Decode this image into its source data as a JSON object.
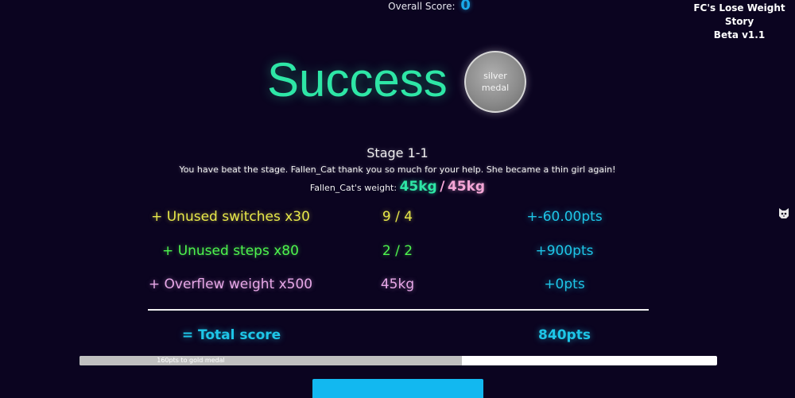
{
  "header": {
    "overall_label": "Overall Score:",
    "overall_value": "0",
    "game_title_line1": "FC's Lose Weight Story",
    "game_title_line2": "Beta v1.1"
  },
  "result": {
    "title": "Success",
    "medal_line1": "silver",
    "medal_line2": "medal",
    "stage_name": "Stage 1-1",
    "message": "You have beat the stage. Fallen_Cat thank you so much for your help. She became a thin girl again!",
    "weight_label": "Fallen_Cat's weight:",
    "weight_current": "45kg",
    "weight_separator": "/",
    "weight_goal": "45kg"
  },
  "score_rows": [
    {
      "label": "+ Unused switches x30",
      "value": "9 / 4",
      "points": "+-60.00pts"
    },
    {
      "label": "+ Unused steps x80",
      "value": "2 / 2",
      "points": "+900pts"
    },
    {
      "label": "+ Overflew weight x500",
      "value": "45kg",
      "points": "+0pts"
    }
  ],
  "total": {
    "label": "= Total score",
    "points": "840pts"
  },
  "progress": {
    "text": "160pts to gold medal",
    "fraction": 0.6
  },
  "icons": {
    "side": "cat-face-icon",
    "medal": "silver-medal-icon"
  },
  "colors": {
    "background": "#0b0420",
    "success": "#2ee6a6",
    "switches": "#e8e84a",
    "steps": "#4ef44e",
    "overflow": "#e8a8e8",
    "points": "#1ec6e8",
    "button": "#12b8f0"
  }
}
